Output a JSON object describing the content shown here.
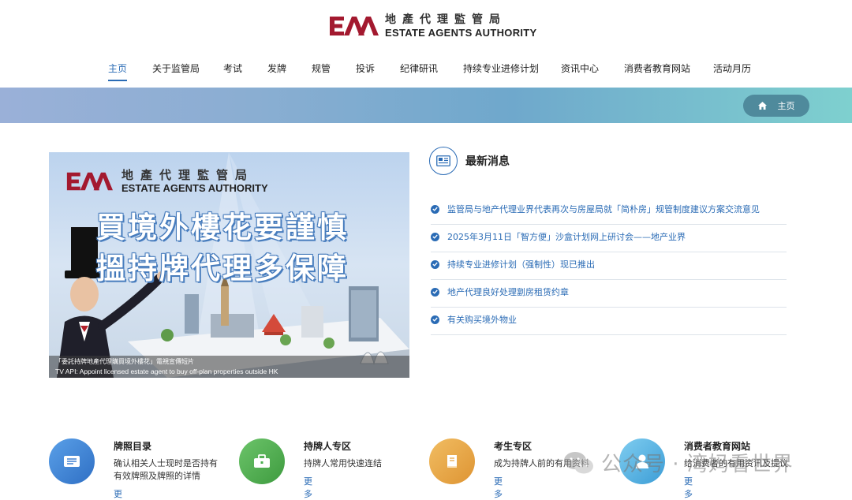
{
  "logo": {
    "cn": "地產代理監管局",
    "en": "ESTATE AGENTS AUTHORITY",
    "mark": "EAA"
  },
  "nav": {
    "items": [
      "主页",
      "关于监管局",
      "考试",
      "发牌",
      "规管",
      "投诉",
      "纪律研讯",
      "持续专业进修计划",
      "资讯中心",
      "消费者教育网站",
      "活动月历"
    ],
    "active": "主页"
  },
  "breadcrumb": {
    "home_label": "主页"
  },
  "hero": {
    "logo_cn": "地產代理監管局",
    "logo_en": "ESTATE AGENTS AUTHORITY",
    "title_line1": "買境外樓花要謹慎",
    "title_line2": "搵持牌代理多保障",
    "caption_cn": "「委託持牌地產代理購買境外樓花」電視宣傳短片",
    "caption_en": "TV API: Appoint licensed estate agent to buy off-plan properties outside HK"
  },
  "news": {
    "heading": "最新消息",
    "items": [
      "监管局与地产代理业界代表再次与房屋局就「简朴房」规管制度建议方案交流意见",
      "2025年3月11日「智方便」沙盒计划网上研讨会——地产业界",
      "持续专业进修计划（强制性）现已推出",
      "地产代理良好处理劏房租赁约章",
      "有关购买境外物业"
    ]
  },
  "quick_links": [
    {
      "title": "牌照目录",
      "desc_line1": "确认相关人士现时是否持有",
      "desc_line2": "有效牌照及牌照的详情",
      "more": "更多",
      "color": "#3f7fd0"
    },
    {
      "title": "持牌人专区",
      "desc_line1": "持牌人常用快速连结",
      "desc_line2": "",
      "more": "更多",
      "color": "#4caf50"
    },
    {
      "title": "考生专区",
      "desc_line1": "成为持牌人前的有用资料",
      "desc_line2": "",
      "more": "更多",
      "color": "#e8a84a"
    },
    {
      "title": "消费者教育网站",
      "desc_line1": "给消费者的有用资讯及提议",
      "desc_line2": "",
      "more": "更多",
      "color": "#5ab4e0"
    }
  ],
  "watermark": {
    "text": "公众号 · 湾妈看世界"
  },
  "colors": {
    "accent": "#2a6bb5",
    "brand_red": "#a3192f"
  }
}
